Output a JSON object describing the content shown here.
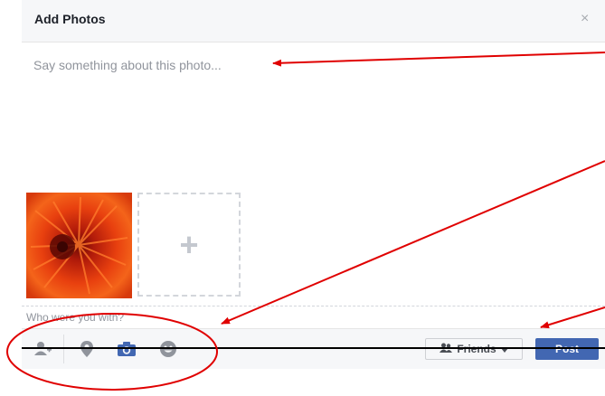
{
  "dialog": {
    "title": "Add Photos",
    "close_glyph": "×",
    "composer_placeholder": "Say something about this photo...",
    "photo": {
      "alt": "orange flower photo"
    },
    "add_more_glyph": "+",
    "tag_hint": "Who were you with?"
  },
  "footer": {
    "icons": [
      "tag-people-icon",
      "location-pin-icon",
      "camera-icon",
      "emoji-icon"
    ],
    "audience_label": "Friends",
    "post_label": "Post"
  },
  "colors": {
    "accent": "#4267b2",
    "annotation": "#e00000"
  }
}
